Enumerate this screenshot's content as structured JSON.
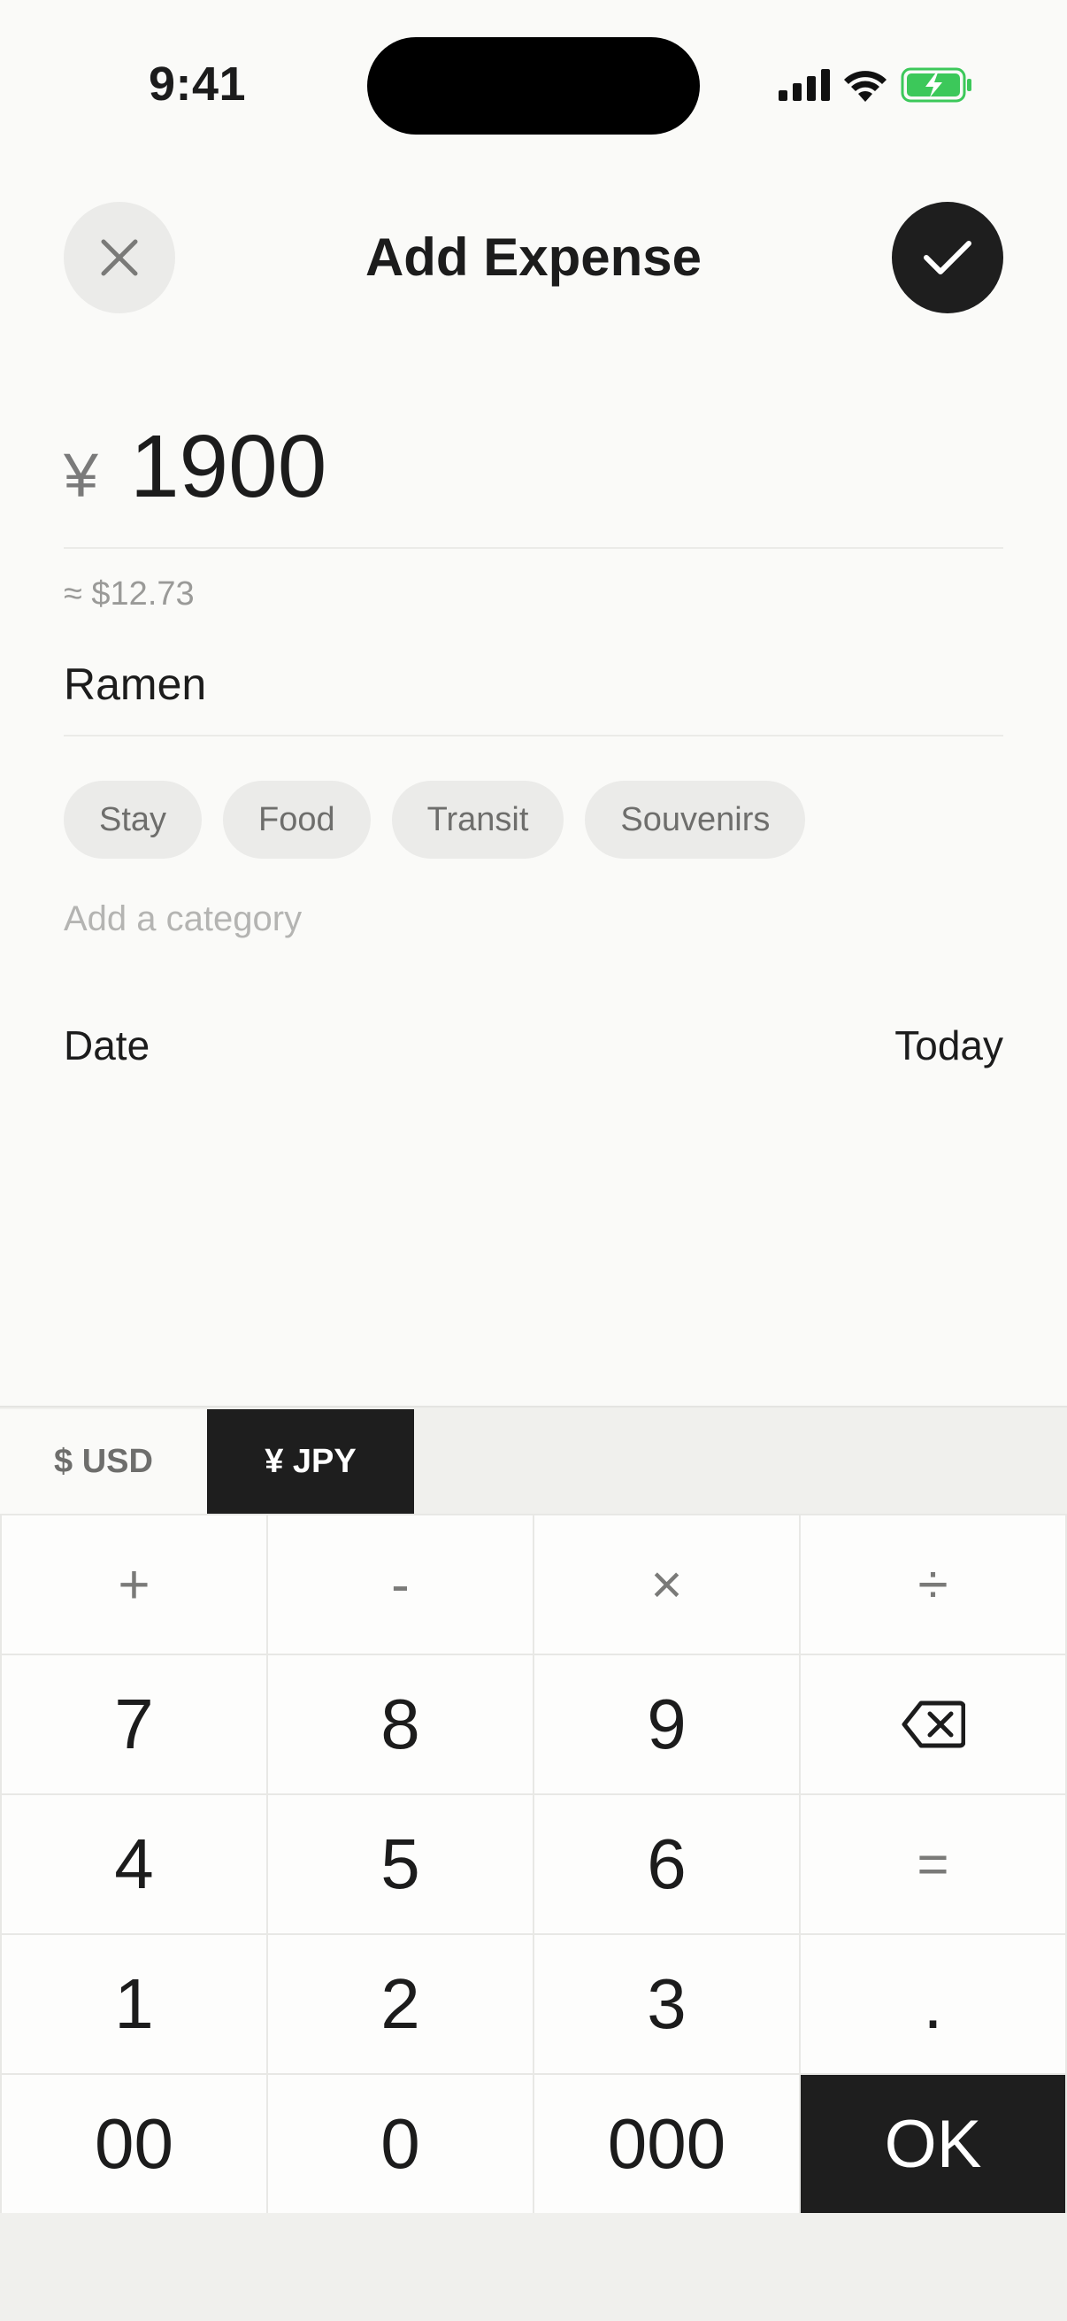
{
  "status_bar": {
    "time": "9:41"
  },
  "header": {
    "title": "Add Expense"
  },
  "amount": {
    "currency_symbol": "¥",
    "value": "1900",
    "converted": "≈ $12.73"
  },
  "note": {
    "value": "Ramen"
  },
  "categories": [
    "Stay",
    "Food",
    "Transit",
    "Souvenirs"
  ],
  "add_category_placeholder": "Add a category",
  "date": {
    "label": "Date",
    "value": "Today"
  },
  "currency_tabs": [
    {
      "label": "$ USD",
      "selected": false
    },
    {
      "label": "¥ JPY",
      "selected": true
    }
  ],
  "keypad": {
    "plus": "+",
    "minus": "-",
    "multiply": "×",
    "divide": "÷",
    "k7": "7",
    "k8": "8",
    "k9": "9",
    "k4": "4",
    "k5": "5",
    "k6": "6",
    "equals": "=",
    "k1": "1",
    "k2": "2",
    "k3": "3",
    "decimal": ".",
    "k00": "00",
    "k0": "0",
    "k000": "000",
    "ok": "OK"
  },
  "colors": {
    "accent": "#1e1e1e",
    "battery_green": "#3cc85a"
  }
}
